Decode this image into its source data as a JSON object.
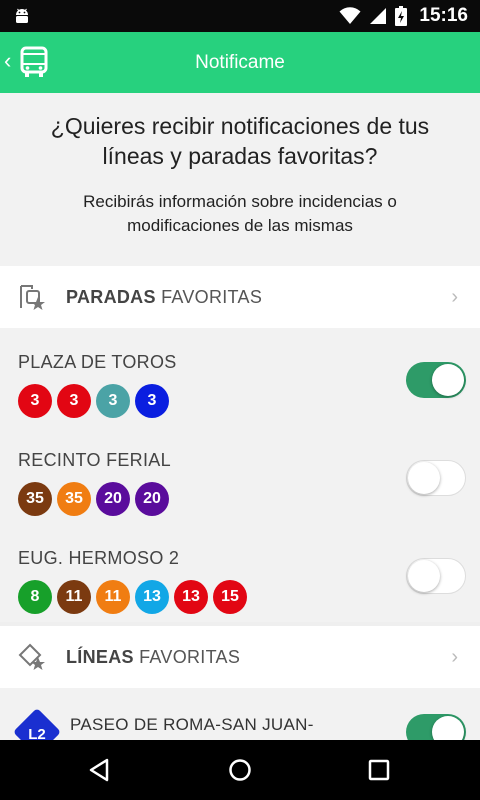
{
  "status_bar": {
    "time": "15:16",
    "icons": [
      "android-icon",
      "wifi-icon",
      "signal-icon",
      "battery-charging-icon"
    ]
  },
  "app_bar": {
    "title": "Notificame",
    "back_glyph": "‹",
    "color": "#27d17e"
  },
  "intro": {
    "question": "¿Quieres recibir notificaciones de tus líneas y paradas favoritas?",
    "subtitle": "Recibirás información sobre incidencias o modificaciones de las mismas"
  },
  "stops_section": {
    "title_bold": "PARADAS",
    "title_rest": " FAVORITAS",
    "icon": "bus-stop-star-icon"
  },
  "stops": [
    {
      "name": "PLAZA DE TOROS",
      "enabled": true,
      "lines": [
        {
          "label": "3",
          "color": "#e20613"
        },
        {
          "label": "3",
          "color": "#e20613"
        },
        {
          "label": "3",
          "color": "#4ba3a6"
        },
        {
          "label": "3",
          "color": "#0a1ee0"
        }
      ]
    },
    {
      "name": "RECINTO FERIAL",
      "enabled": false,
      "lines": [
        {
          "label": "35",
          "color": "#7b3a10"
        },
        {
          "label": "35",
          "color": "#f07d12"
        },
        {
          "label": "20",
          "color": "#5a0c9c"
        },
        {
          "label": "20",
          "color": "#5a0c9c"
        }
      ]
    },
    {
      "name": "EUG. HERMOSO 2",
      "enabled": false,
      "lines": [
        {
          "label": "8",
          "color": "#17a02a"
        },
        {
          "label": "11",
          "color": "#7b3a10"
        },
        {
          "label": "11",
          "color": "#f07d12"
        },
        {
          "label": "13",
          "color": "#12a7e6"
        },
        {
          "label": "13",
          "color": "#e20613"
        },
        {
          "label": "15",
          "color": "#e20613"
        }
      ]
    }
  ],
  "lines_section": {
    "title_bold": "LÍNEAS",
    "title_rest": " FAVORITAS",
    "icon": "route-star-icon"
  },
  "favorite_lines": [
    {
      "badge": "L2",
      "badge_color": "#1a2fd0",
      "name": "PASEO DE ROMA-SAN JUAN-PASEO DE ROMA",
      "enabled": true
    }
  ],
  "nav_bar": {
    "buttons": [
      "back-nav-icon",
      "home-nav-icon",
      "recents-nav-icon"
    ]
  }
}
